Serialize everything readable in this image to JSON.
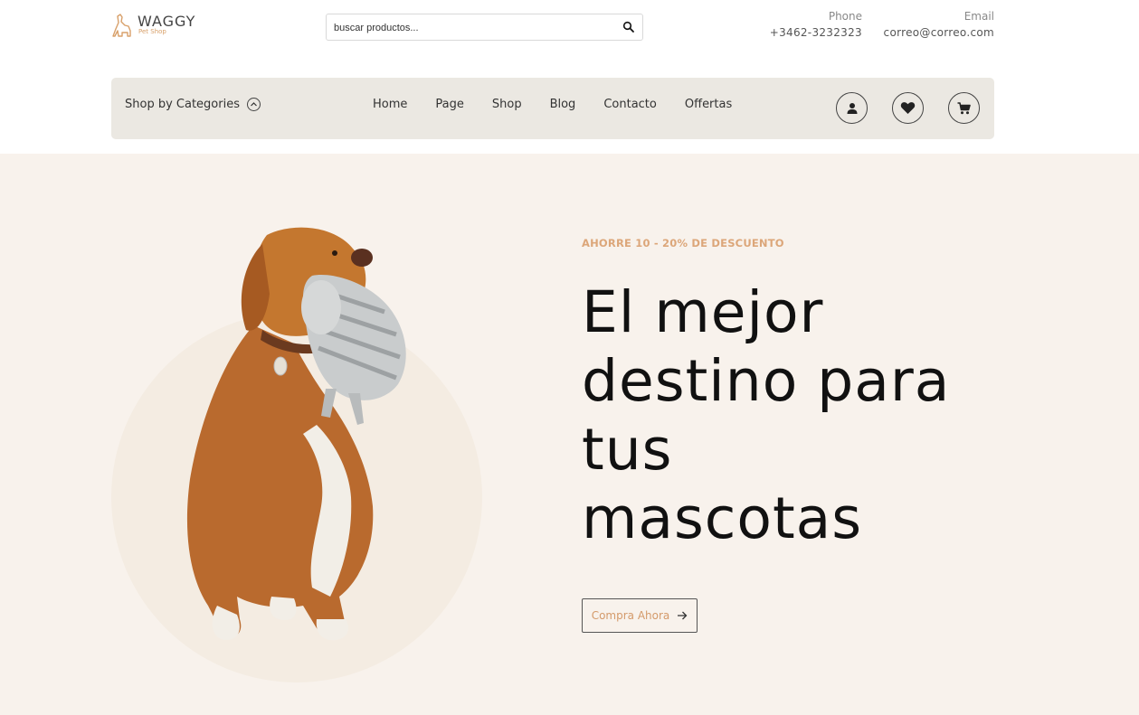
{
  "brand": {
    "name": "WAGGY",
    "tagline": "Pet Shop",
    "accent": "#dca679"
  },
  "search": {
    "placeholder": "buscar productos..."
  },
  "contact": {
    "phone_label": "Phone",
    "phone_value": "+3462-3232323",
    "email_label": "Email",
    "email_value": "correo@correo.com"
  },
  "nav": {
    "categories_label": "Shop by Categories",
    "items": [
      "Home",
      "Page",
      "Shop",
      "Blog",
      "Contacto",
      "Offertas"
    ],
    "icons": [
      "user-icon",
      "heart-icon",
      "cart-icon"
    ]
  },
  "hero": {
    "discount": "AHORRE 10 - 20% DE DESCUENTO",
    "headline_lines": [
      "El mejor",
      "destino para",
      "tus",
      "mascotas"
    ],
    "cta_label": "Compra Ahora",
    "background": "#f8f2ec"
  }
}
